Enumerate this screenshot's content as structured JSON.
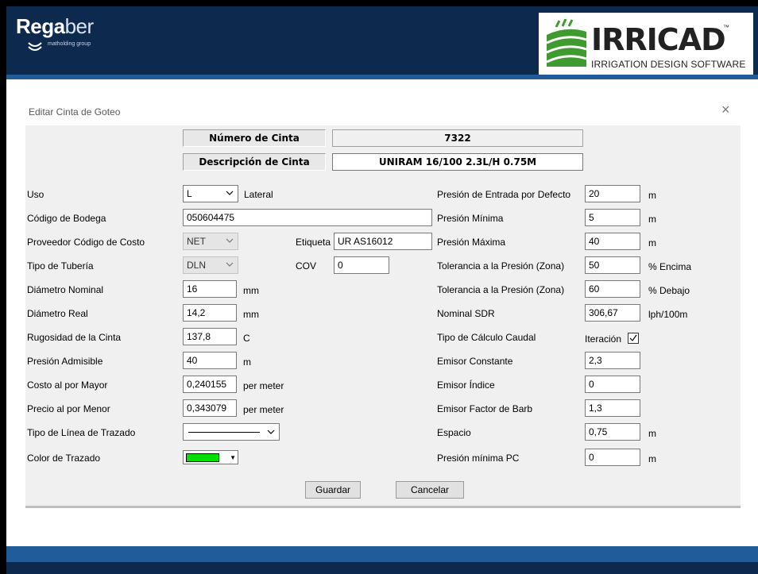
{
  "header": {
    "brand_left_bold": "Rega",
    "brand_left_light": "ber",
    "brand_left_sub": "matholding group",
    "brand_right_title": "IRRICAD",
    "brand_right_tm": "™",
    "brand_right_subtitle": "IRRIGATION DESIGN SOFTWARE"
  },
  "dialog": {
    "title": "Editar Cinta de Goteo",
    "close": "×",
    "numero_label": "Número de Cinta",
    "numero_value": "7322",
    "descripcion_label": "Descripción de Cinta",
    "descripcion_value": "UNIRAM 16/100 2.3L/H 0.75M"
  },
  "left": {
    "uso_label": "Uso",
    "uso_value": "L",
    "uso_text": "Lateral",
    "codigo_label": "Código de Bodega",
    "codigo_value": "050604475",
    "proveedor_label": "Proveedor Código de Costo",
    "proveedor_value": "NET",
    "etiqueta_label": "Etiqueta",
    "etiqueta_value": "UR AS16012",
    "tuberia_label": "Tipo de Tubería",
    "tuberia_value": "DLN",
    "cov_label": "COV",
    "cov_value": "0",
    "diam_nom_label": "Diámetro Nominal",
    "diam_nom_value": "16",
    "diam_nom_unit": "mm",
    "diam_real_label": "Diámetro Real",
    "diam_real_value": "14,2",
    "diam_real_unit": "mm",
    "rug_label": "Rugosidad de la Cinta",
    "rug_value": "137,8",
    "rug_unit": "C",
    "pres_adm_label": "Presión Admisible",
    "pres_adm_value": "40",
    "pres_adm_unit": "m",
    "costo_label": "Costo al por Mayor",
    "costo_value": "0,240155",
    "costo_unit": "per meter",
    "precio_label": "Precio al por Menor",
    "precio_value": "0,343079",
    "precio_unit": "per meter",
    "linea_label": "Tipo de Línea de Trazado",
    "color_label": "Color de Trazado"
  },
  "right": {
    "pent_label": "Presión de Entrada por Defecto",
    "pent_value": "20",
    "pent_unit": "m",
    "pmin_label": "Presión Mínima",
    "pmin_value": "5",
    "pmin_unit": "m",
    "pmax_label": "Presión Máxima",
    "pmax_value": "40",
    "pmax_unit": "m",
    "tol1_label": "Tolerancia a la Presión (Zona)",
    "tol1_value": "50",
    "tol1_unit": "% Encima",
    "tol2_label": "Tolerancia a la Presión (Zona)",
    "tol2_value": "60",
    "tol2_unit": "% Debajo",
    "sdr_label": "Nominal SDR",
    "sdr_value": "306,67",
    "sdr_unit": "lph/100m",
    "calc_label": "Tipo de Cálculo Caudal",
    "calc_value": "Iteración",
    "econst_label": "Emisor Constante",
    "econst_value": "2,3",
    "eind_label": "Emisor Índice",
    "eind_value": "0",
    "ebarb_label": "Emisor Factor de Barb",
    "ebarb_value": "1,3",
    "esp_label": "Espacio",
    "esp_value": "0,75",
    "esp_unit": "m",
    "pmpc_label": "Presión mínima PC",
    "pmpc_value": "0",
    "pmpc_unit": "m"
  },
  "buttons": {
    "save": "Guardar",
    "cancel": "Cancelar"
  },
  "colors": {
    "trace_color": "#00e000",
    "banner": "#0d2a4e",
    "band": "#1f5c99"
  }
}
